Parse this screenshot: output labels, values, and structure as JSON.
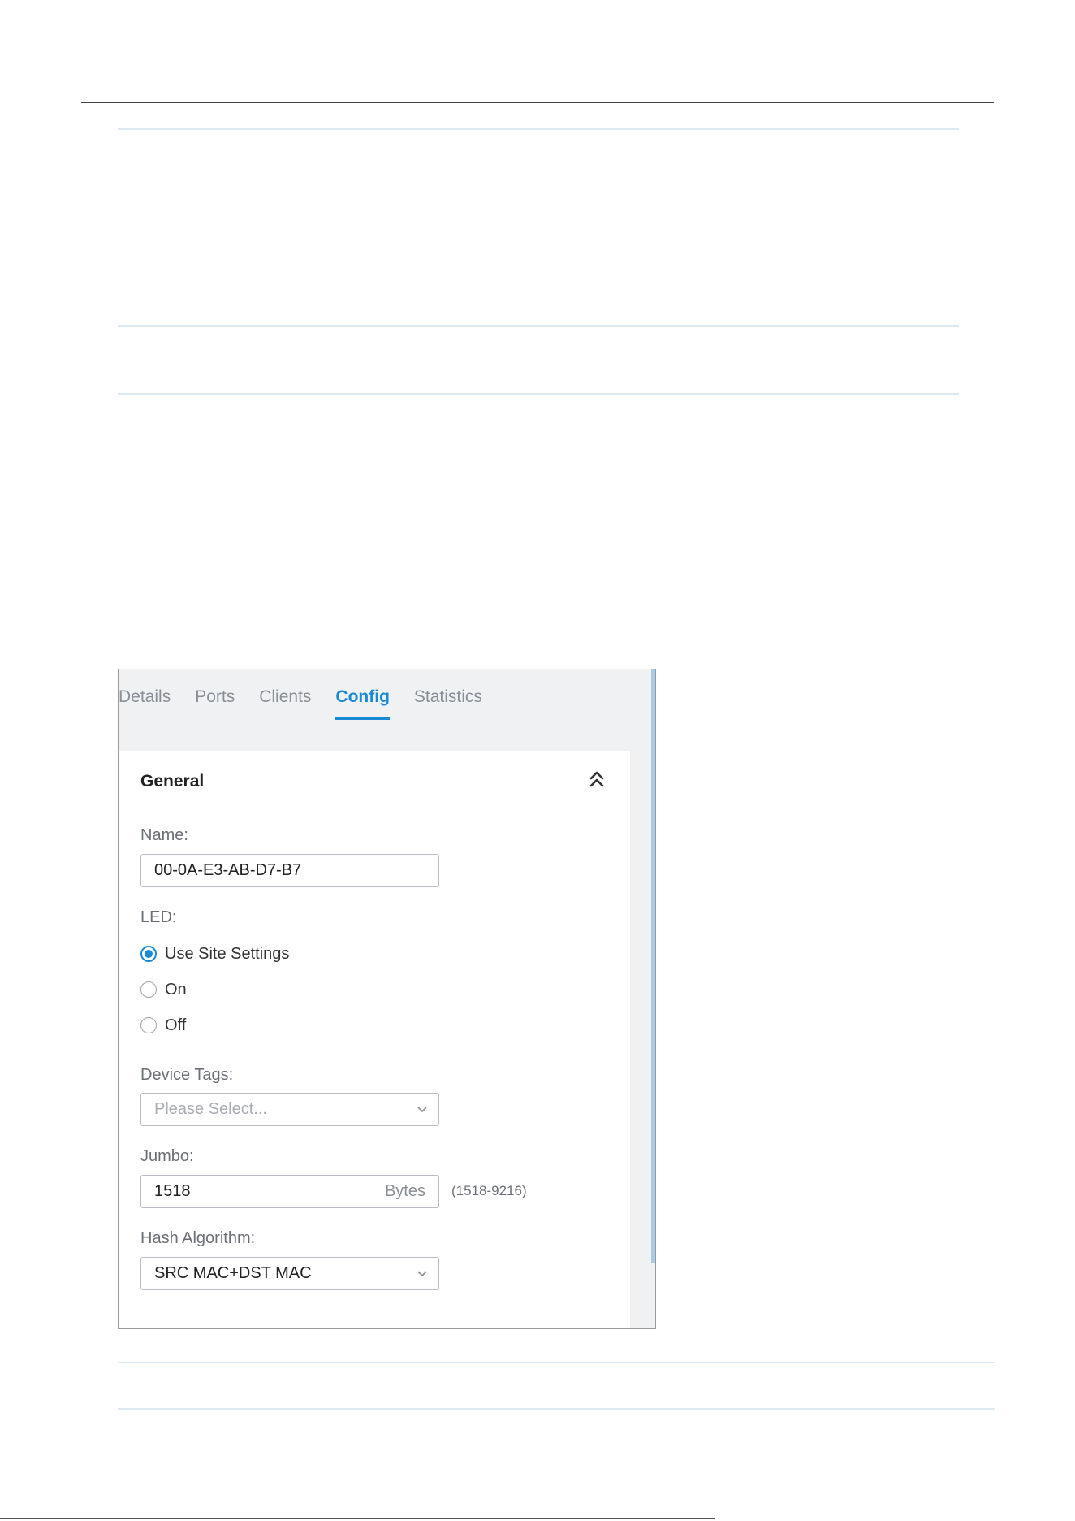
{
  "tabs": [
    "Details",
    "Ports",
    "Clients",
    "Config",
    "Statistics"
  ],
  "active_tab": "Config",
  "section": {
    "title": "General",
    "collapse_icon": "double-chevron-up-icon"
  },
  "name": {
    "label": "Name:",
    "value": "00-0A-E3-AB-D7-B7"
  },
  "led": {
    "label": "LED:",
    "options": [
      "Use Site Settings",
      "On",
      "Off"
    ],
    "selected": "Use Site Settings"
  },
  "device_tags": {
    "label": "Device Tags:",
    "placeholder": "Please Select..."
  },
  "jumbo": {
    "label": "Jumbo:",
    "value": "1518",
    "unit": "Bytes",
    "range": "(1518-9216)"
  },
  "hash": {
    "label": "Hash Algorithm:",
    "value": "SRC MAC+DST MAC"
  },
  "colors": {
    "accent": "#1a8ad6",
    "scrollbar": "#a8cbe6"
  }
}
